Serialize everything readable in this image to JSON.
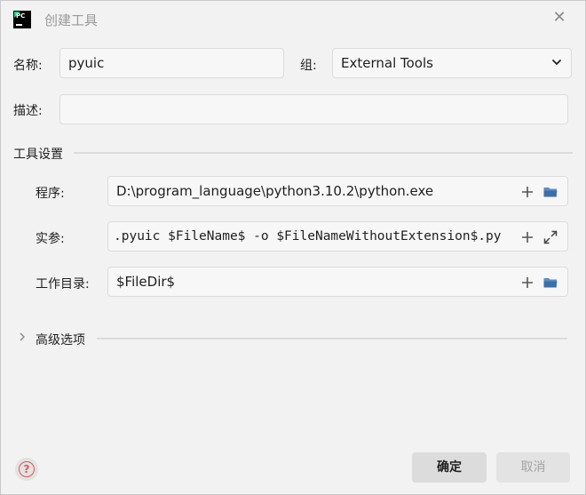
{
  "window": {
    "title": "创建工具"
  },
  "form": {
    "name_label": "名称:",
    "name_value": "pyuic",
    "group_label": "组:",
    "group_value": "External Tools",
    "description_label": "描述:",
    "description_value": ""
  },
  "tool_settings": {
    "title": "工具设置",
    "program_label": "程序:",
    "program_value": "D:\\program_language\\python3.10.2\\python.exe",
    "arguments_label": "实参:",
    "arguments_value": ".pyuic $FileName$ -o $FileNameWithoutExtension$.py",
    "workdir_label": "工作目录:",
    "workdir_value": "$FileDir$"
  },
  "advanced": {
    "title": "高级选项",
    "expanded": false
  },
  "footer": {
    "ok_label": "确定",
    "cancel_label": "取消",
    "cancel_enabled": false
  },
  "icons": {
    "app": "pycharm-icon",
    "close": "close-icon",
    "dropdown": "chevron-down-icon",
    "add": "plus-icon",
    "browse": "folder-icon",
    "expand": "expand-icon",
    "help": "help-icon",
    "advanced_toggle": "chevron-right-icon"
  },
  "colors": {
    "background": "#f2f2f2",
    "field_bg": "#f7f7f7",
    "folder": "#5b8ec5",
    "help_red": "#e0555b",
    "pycharm_green": "#21d789"
  }
}
